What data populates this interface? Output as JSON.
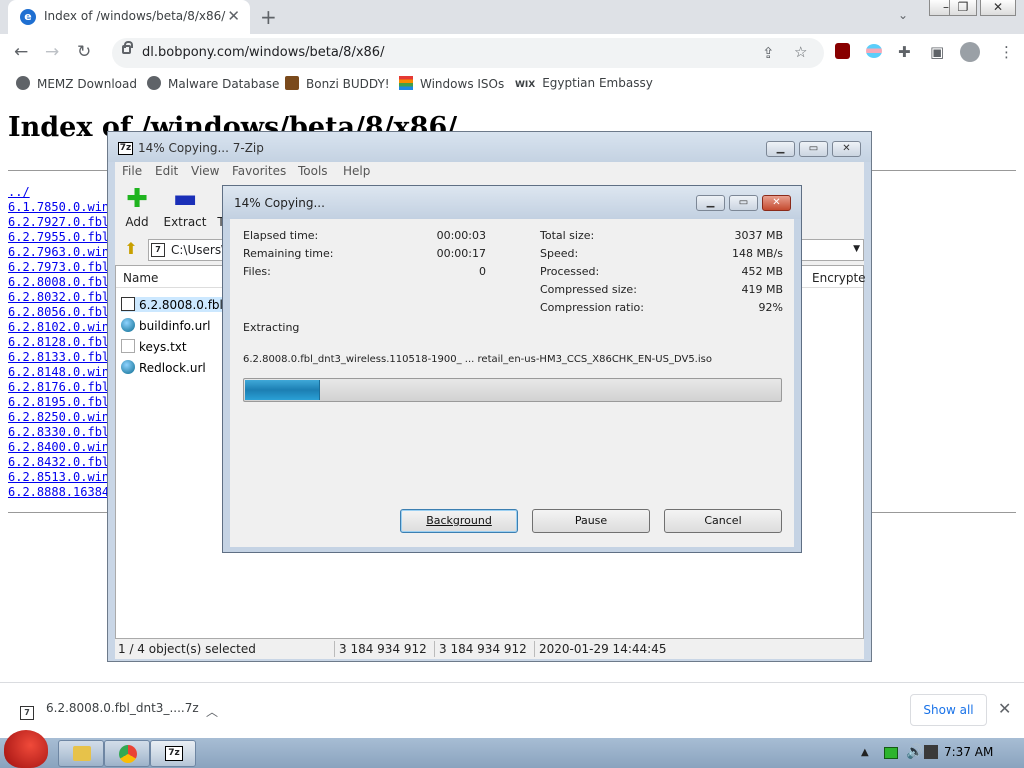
{
  "browser": {
    "tab_title": "Index of /windows/beta/8/x86/",
    "url": "dl.bobpony.com/windows/beta/8/x86/",
    "bookmarks": [
      "MEMZ Download",
      "Malware Database",
      "Bonzi BUDDY!",
      "Windows ISOs",
      "Egyptian Embassy"
    ]
  },
  "page": {
    "heading": "Index of /windows/beta/8/x86/",
    "links": [
      "../",
      "6.1.7850.0.winmain",
      "6.2.7927.0.fbl_core",
      "6.2.7955.0.fbl_shell",
      "6.2.7963.0.winmain",
      "6.2.7973.0.fbl_core",
      "6.2.8008.0.fbl_dnt3",
      "6.2.8032.0.fbl_core",
      "6.2.8056.0.fbl_core",
      "6.2.8102.0.winmain",
      "6.2.8128.0.fbl_core",
      "6.2.8133.0.fbl_core",
      "6.2.8148.0.winmain",
      "6.2.8176.0.fbl_core",
      "6.2.8195.0.fbl_core",
      "6.2.8250.0.winmain",
      "6.2.8330.0.fbl_core",
      "6.2.8400.0.winmain",
      "6.2.8432.0.fbl_core",
      "6.2.8513.0.winmain",
      "6.2.8888.16384"
    ]
  },
  "zip_window": {
    "title": "14% Copying... 7-Zip",
    "menu": [
      "File",
      "Edit",
      "View",
      "Favorites",
      "Tools",
      "Help"
    ],
    "toolbar": {
      "add": "Add",
      "extract": "Extract",
      "test": "T"
    },
    "path": "C:\\Users\\",
    "columns": {
      "name": "Name",
      "encrypted": "Encrypte"
    },
    "files": [
      "6.2.8008.0.fbl_d",
      "buildinfo.url",
      "keys.txt",
      "Redlock.url"
    ],
    "status": {
      "selected": "1 / 4 object(s) selected",
      "size": "3 184 934 912",
      "packed": "3 184 934 912",
      "modified": "2020-01-29 14:44:45"
    }
  },
  "progress_dialog": {
    "title": "14% Copying...",
    "left": [
      {
        "label": "Elapsed time:",
        "value": "00:00:03"
      },
      {
        "label": "Remaining time:",
        "value": "00:00:17"
      },
      {
        "label": "Files:",
        "value": "0"
      }
    ],
    "right": [
      {
        "label": "Total size:",
        "value": "3037 MB"
      },
      {
        "label": "Speed:",
        "value": "148 MB/s"
      },
      {
        "label": "Processed:",
        "value": "452 MB"
      },
      {
        "label": "Compressed size:",
        "value": "419 MB"
      },
      {
        "label": "Compression ratio:",
        "value": "92%"
      }
    ],
    "operation": "Extracting",
    "current_file": "6.2.8008.0.fbl_dnt3_wireless.110518-1900_ ... retail_en-us-HM3_CCS_X86CHK_EN-US_DV5.iso",
    "progress_fraction": 0.14,
    "buttons": {
      "background": "Background",
      "pause": "Pause",
      "cancel": "Cancel"
    }
  },
  "downloads": {
    "file": "6.2.8008.0.fbl_dnt3_....7z",
    "show_all": "Show all"
  },
  "taskbar": {
    "clock": "7:37 AM"
  },
  "colors": {
    "link": "#0000ee",
    "progress": "#2a9fd6",
    "chrome_blue": "#1a73e8"
  }
}
